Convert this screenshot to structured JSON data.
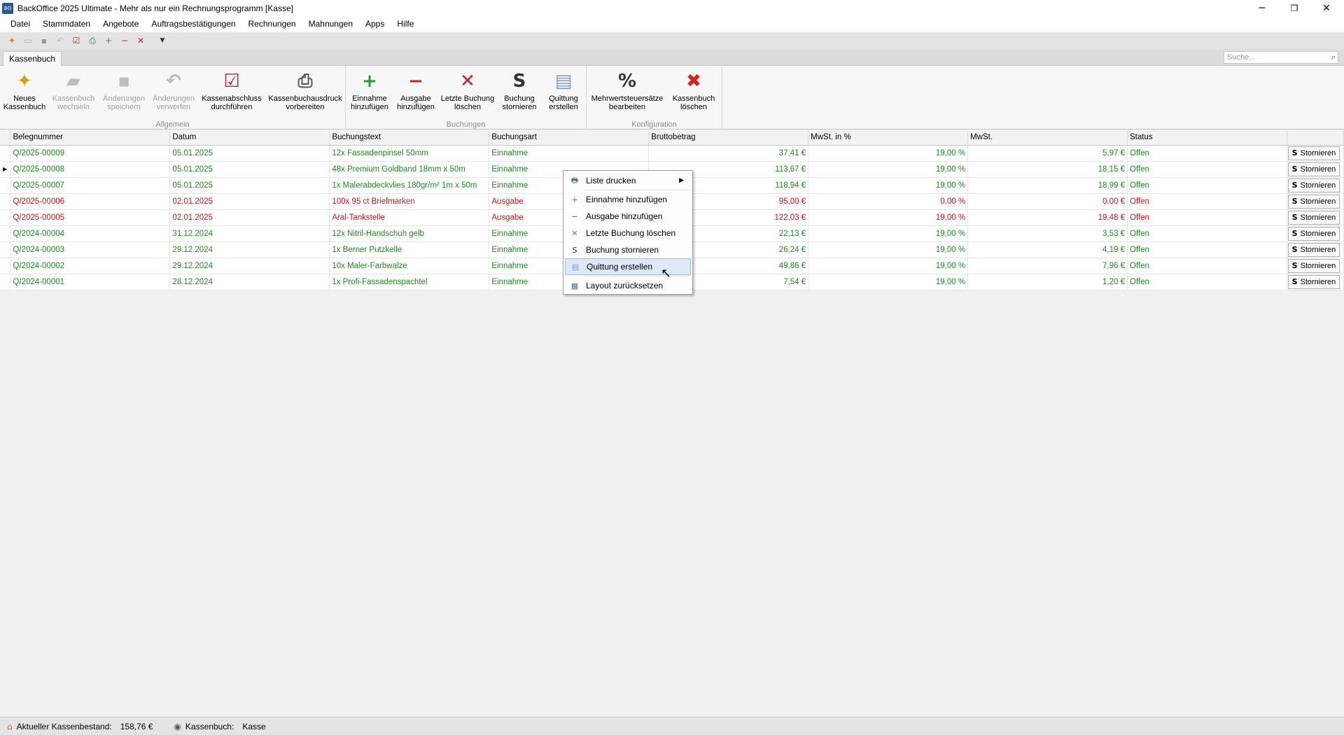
{
  "window": {
    "title": "BackOffice 2025 Ultimate - Mehr als nur ein Rechnungsprogramm [Kasse]",
    "app_icon": "BO",
    "minimize": "─",
    "restore": "❐",
    "close": "✕"
  },
  "menu": [
    "Datei",
    "Stammdaten",
    "Angebote",
    "Auftragsbestätigungen",
    "Rechnungen",
    "Mahnungen",
    "Apps",
    "Hilfe"
  ],
  "tab": {
    "label": "Kassenbuch"
  },
  "search": {
    "placeholder": "Suche..."
  },
  "ribbon": {
    "groups": {
      "allgemein": "Allgemein",
      "buchungen": "Buchungen",
      "konfiguration": "Konfiguration"
    },
    "buttons": {
      "neues_kassenbuch": "Neues\nKassenbuch",
      "kassenbuch_wechseln": "Kassenbuch\nwechseln",
      "aenderungen_speichern": "Änderungen\nspeichern",
      "aenderungen_verwerfen": "Änderungen\nverwerfen",
      "kassenabschluss": "Kassenabschluss\ndurchführen",
      "kassenbuchausdruck": "Kassenbuchausdruck\nvorbereiten",
      "einnahme_hinzufuegen": "Einnahme\nhinzufügen",
      "ausgabe_hinzufuegen": "Ausgabe\nhinzufügen",
      "letzte_buchung_loeschen": "Letzte Buchung\nlöschen",
      "buchung_stornieren": "Buchung\nstornieren",
      "quittung_erstellen": "Quittung\nerstellen",
      "mwst_bearbeiten": "Mehrwertsteuersätze\nbearbeiten",
      "kassenbuch_loeschen": "Kassenbuch\nlöschen"
    }
  },
  "table": {
    "headers": {
      "belegnummer": "Belegnummer",
      "datum": "Datum",
      "buchungstext": "Buchungstext",
      "buchungsart": "Buchungsart",
      "bruttobetrag": "Bruttobetrag",
      "mwst_prozent": "MwSt. in %",
      "mwst": "MwSt.",
      "status": "Status"
    },
    "action_label": "Stornieren",
    "rows": [
      {
        "beleg": "Q/2025-00009",
        "datum": "05.01.2025",
        "text": "12x Fassadenpinsel 50mm",
        "art": "Einnahme",
        "brutto": "37,41 €",
        "pct": "19,00 %",
        "mwst": "5,97 €",
        "status": "Offen",
        "type": "in",
        "current": ""
      },
      {
        "beleg": "Q/2025-00008",
        "datum": "05.01.2025",
        "text": "48x Premium Goldband 18mm x 50m",
        "art": "Einnahme",
        "brutto": "113,67 €",
        "pct": "19,00 %",
        "mwst": "18,15 €",
        "status": "Offen",
        "type": "in",
        "current": "▶"
      },
      {
        "beleg": "Q/2025-00007",
        "datum": "05.01.2025",
        "text": "1x Malerabdeckvlies 180gr/m² 1m x 50m",
        "art": "Einnahme",
        "brutto": "118,94 €",
        "pct": "19,00 %",
        "mwst": "18,99 €",
        "status": "Offen",
        "type": "in",
        "current": ""
      },
      {
        "beleg": "Q/2025-00006",
        "datum": "02.01.2025",
        "text": "100x 95 ct Briefmarken",
        "art": "Ausgabe",
        "brutto": "95,00 €",
        "pct": "0,00 %",
        "mwst": "0,00 €",
        "status": "Offen",
        "type": "out",
        "current": ""
      },
      {
        "beleg": "Q/2025-00005",
        "datum": "02.01.2025",
        "text": "Aral-Tankstelle",
        "art": "Ausgabe",
        "brutto": "122,03 €",
        "pct": "19,00 %",
        "mwst": "19,48 €",
        "status": "Offen",
        "type": "out",
        "current": ""
      },
      {
        "beleg": "Q/2024-00004",
        "datum": "31.12.2024",
        "text": "12x Nitril-Handschuh gelb",
        "art": "Einnahme",
        "brutto": "22,13 €",
        "pct": "19,00 %",
        "mwst": "3,53 €",
        "status": "Offen",
        "type": "in",
        "current": ""
      },
      {
        "beleg": "Q/2024-00003",
        "datum": "29.12.2024",
        "text": "1x Berner Putzkelle",
        "art": "Einnahme",
        "brutto": "26,24 €",
        "pct": "19,00 %",
        "mwst": "4,19 €",
        "status": "Offen",
        "type": "in",
        "current": ""
      },
      {
        "beleg": "Q/2024-00002",
        "datum": "29.12.2024",
        "text": "10x Maler-Farbwalze",
        "art": "Einnahme",
        "brutto": "49,86 €",
        "pct": "19,00 %",
        "mwst": "7,96 €",
        "status": "Offen",
        "type": "in",
        "current": ""
      },
      {
        "beleg": "Q/2024-00001",
        "datum": "28.12.2024",
        "text": "1x Profi-Fassadenspachtel",
        "art": "Einnahme",
        "brutto": "7,54 €",
        "pct": "19,00 %",
        "mwst": "1,20 €",
        "status": "Offen",
        "type": "in",
        "current": ""
      }
    ]
  },
  "context_menu": {
    "items": [
      {
        "label": "Liste drucken",
        "icon": "printer-icon",
        "glyph": "🖶",
        "submenu": "▶",
        "highlighted": false
      },
      {
        "label": "Einnahme hinzufügen",
        "icon": "add-income-icon",
        "glyph": "+",
        "highlighted": false
      },
      {
        "label": "Ausgabe hinzufügen",
        "icon": "add-expense-icon",
        "glyph": "−",
        "highlighted": false
      },
      {
        "label": "Letzte Buchung löschen",
        "icon": "delete-booking-icon",
        "glyph": "✕",
        "highlighted": false
      },
      {
        "label": "Buchung stornieren",
        "icon": "cancel-booking-icon",
        "glyph": "S",
        "highlighted": false
      },
      {
        "label": "Quittung erstellen",
        "icon": "receipt-icon",
        "glyph": "▤",
        "highlighted": true
      },
      {
        "label": "Layout zurücksetzen",
        "icon": "reset-layout-icon",
        "glyph": "▦",
        "highlighted": false
      }
    ]
  },
  "status": {
    "kassenbestand_label": "Aktueller Kassenbestand:",
    "kassenbestand_value": "158,76 €",
    "kassenbuch_label": "Kassenbuch:",
    "kassenbuch_value": "Kasse"
  },
  "colors": {
    "income": "#1e8c1e",
    "expense": "#e01010",
    "highlight": "#dde8f8"
  }
}
